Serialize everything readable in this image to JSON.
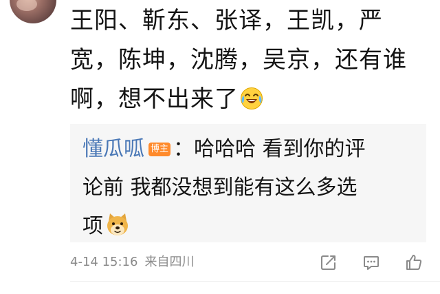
{
  "comment": {
    "lines": [
      "王阳、靳东、张译，王凯，严",
      "宽，陈坤，沈腾，吴京，还有谁",
      "啊，想不出来了"
    ],
    "trailing_emoji": "laughing-crying-emoji"
  },
  "reply": {
    "username": "懂瓜呱",
    "badge": "博主",
    "separator": "：",
    "line1": "哈哈哈 看到你的评",
    "line2": "论前 我都没想到能有这么多选",
    "line3": "项",
    "trailing_emoji": "doge-emoji"
  },
  "meta": {
    "timestamp": "4-14 15:16",
    "location": "来自四川"
  },
  "actions": {
    "share_icon": "share-icon",
    "comment_icon": "comment-icon",
    "like_icon": "like-icon"
  },
  "colors": {
    "text": "#141414",
    "username": "#4a78b6",
    "badge": "#ff8a2b",
    "meta": "#8a8a8a",
    "reply_bg": "#f6f6f6"
  }
}
